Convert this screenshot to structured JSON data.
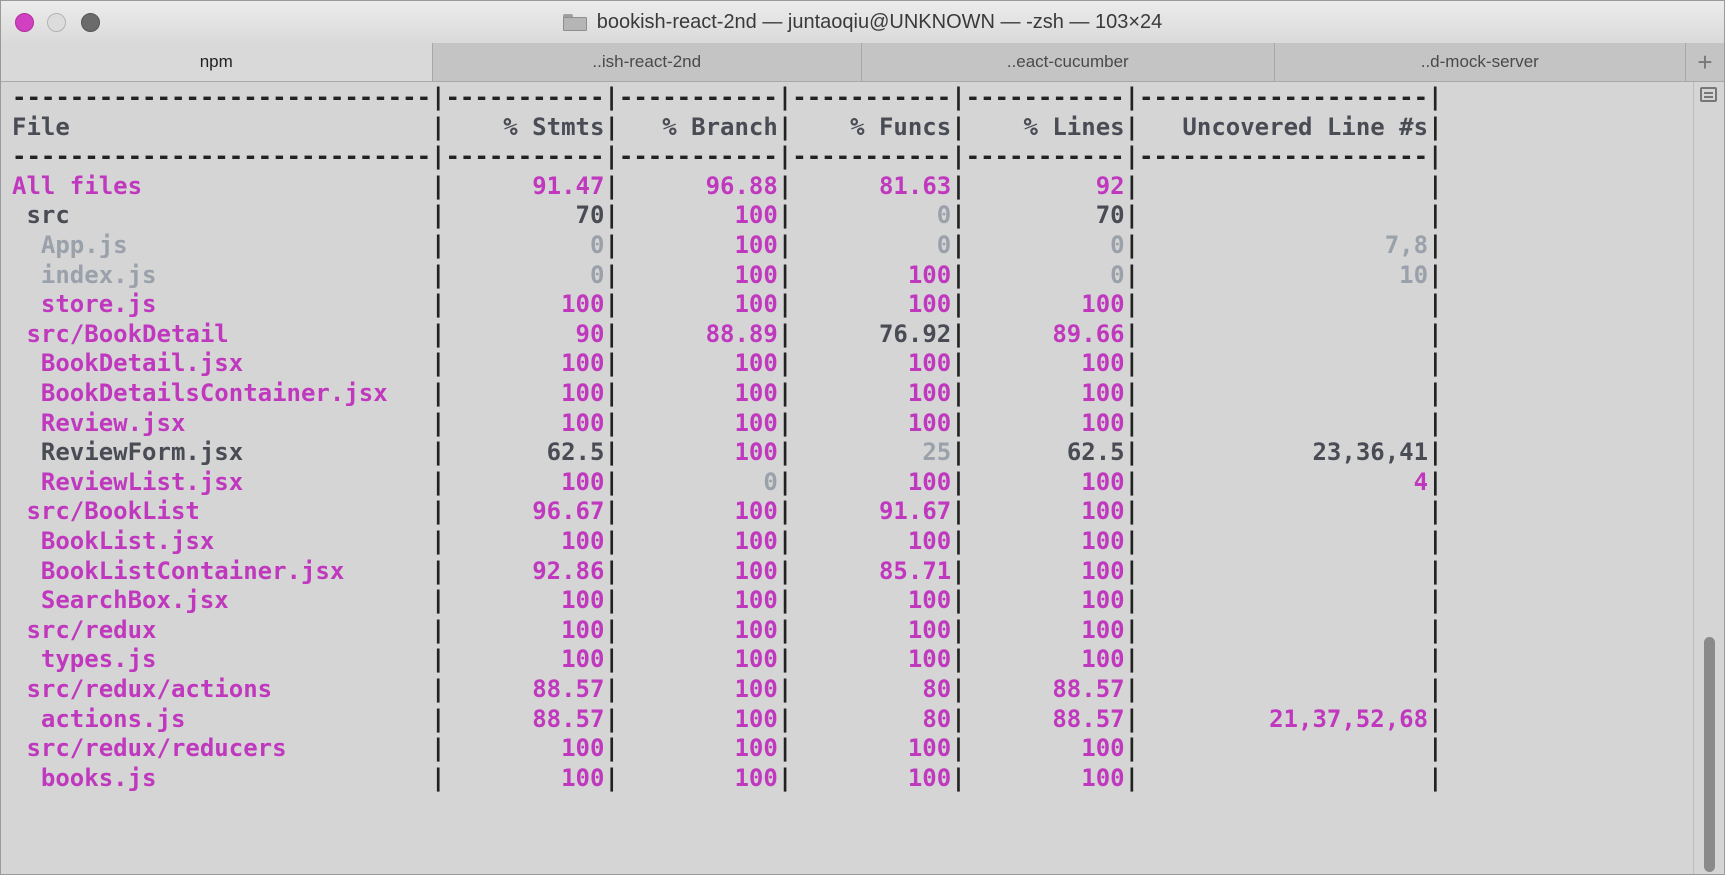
{
  "window": {
    "title": "bookish-react-2nd — juntaoqiu@UNKNOWN — -zsh — 103×24"
  },
  "tabs": [
    {
      "label": "npm",
      "active": true
    },
    {
      "label": "..ish-react-2nd",
      "active": false
    },
    {
      "label": "..eact-cucumber",
      "active": false
    },
    {
      "label": "..d-mock-server",
      "active": false
    }
  ],
  "coverage": {
    "separator": "-----------------------------|-----------|-----------|-----------|-----------|--------------------|",
    "headers": [
      "File",
      "% Stmts",
      "% Branch",
      "% Funcs",
      "% Lines",
      "Uncovered Line #s"
    ],
    "rows": [
      {
        "file": "All files",
        "stmts": "91.47",
        "branch": "96.88",
        "funcs": "81.63",
        "lines": "92",
        "uncovered": ""
      },
      {
        "file": " src",
        "stmts": "70",
        "branch": "100",
        "funcs": "0",
        "lines": "70",
        "uncovered": ""
      },
      {
        "file": "  App.js",
        "stmts": "0",
        "branch": "100",
        "funcs": "0",
        "lines": "0",
        "uncovered": "7,8"
      },
      {
        "file": "  index.js",
        "stmts": "0",
        "branch": "100",
        "funcs": "100",
        "lines": "0",
        "uncovered": "10"
      },
      {
        "file": "  store.js",
        "stmts": "100",
        "branch": "100",
        "funcs": "100",
        "lines": "100",
        "uncovered": ""
      },
      {
        "file": " src/BookDetail",
        "stmts": "90",
        "branch": "88.89",
        "funcs": "76.92",
        "lines": "89.66",
        "uncovered": ""
      },
      {
        "file": "  BookDetail.jsx",
        "stmts": "100",
        "branch": "100",
        "funcs": "100",
        "lines": "100",
        "uncovered": ""
      },
      {
        "file": "  BookDetailsContainer.jsx",
        "stmts": "100",
        "branch": "100",
        "funcs": "100",
        "lines": "100",
        "uncovered": ""
      },
      {
        "file": "  Review.jsx",
        "stmts": "100",
        "branch": "100",
        "funcs": "100",
        "lines": "100",
        "uncovered": ""
      },
      {
        "file": "  ReviewForm.jsx",
        "stmts": "62.5",
        "branch": "100",
        "funcs": "25",
        "lines": "62.5",
        "uncovered": "23,36,41"
      },
      {
        "file": "  ReviewList.jsx",
        "stmts": "100",
        "branch": "0",
        "funcs": "100",
        "lines": "100",
        "uncovered": "4"
      },
      {
        "file": " src/BookList",
        "stmts": "96.67",
        "branch": "100",
        "funcs": "91.67",
        "lines": "100",
        "uncovered": ""
      },
      {
        "file": "  BookList.jsx",
        "stmts": "100",
        "branch": "100",
        "funcs": "100",
        "lines": "100",
        "uncovered": ""
      },
      {
        "file": "  BookListContainer.jsx",
        "stmts": "92.86",
        "branch": "100",
        "funcs": "85.71",
        "lines": "100",
        "uncovered": ""
      },
      {
        "file": "  SearchBox.jsx",
        "stmts": "100",
        "branch": "100",
        "funcs": "100",
        "lines": "100",
        "uncovered": ""
      },
      {
        "file": " src/redux",
        "stmts": "100",
        "branch": "100",
        "funcs": "100",
        "lines": "100",
        "uncovered": ""
      },
      {
        "file": "  types.js",
        "stmts": "100",
        "branch": "100",
        "funcs": "100",
        "lines": "100",
        "uncovered": ""
      },
      {
        "file": " src/redux/actions",
        "stmts": "88.57",
        "branch": "100",
        "funcs": "80",
        "lines": "88.57",
        "uncovered": ""
      },
      {
        "file": "  actions.js",
        "stmts": "88.57",
        "branch": "100",
        "funcs": "80",
        "lines": "88.57",
        "uncovered": "21,37,52,68"
      },
      {
        "file": " src/redux/reducers",
        "stmts": "100",
        "branch": "100",
        "funcs": "100",
        "lines": "100",
        "uncovered": ""
      },
      {
        "file": "  books.js",
        "stmts": "100",
        "branch": "100",
        "funcs": "100",
        "lines": "100",
        "uncovered": ""
      }
    ]
  },
  "colors": {
    "high": "#c038be",
    "medium": "#4a4c55",
    "low": "#9aa1aa"
  }
}
